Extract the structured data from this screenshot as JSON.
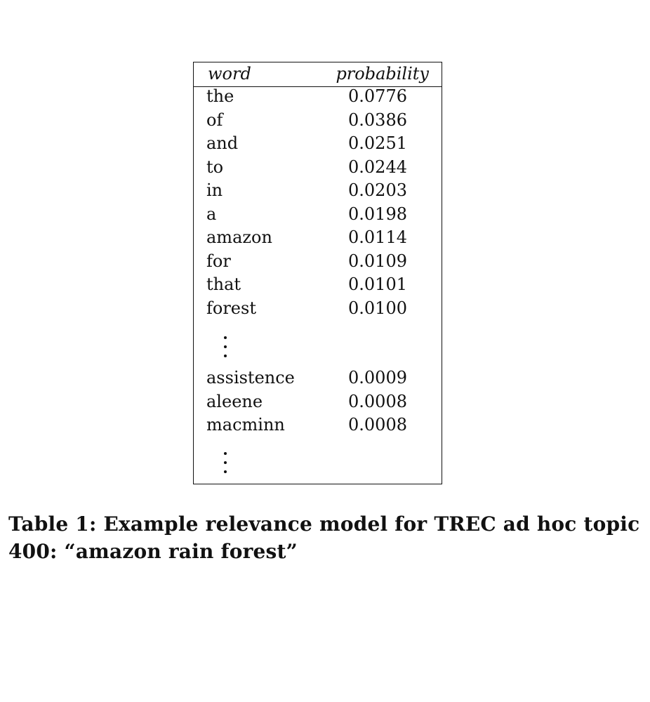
{
  "table": {
    "headers": {
      "word": "word",
      "probability": "probability"
    },
    "rows_top": [
      {
        "word": "the",
        "probability": "0.0776"
      },
      {
        "word": "of",
        "probability": "0.0386"
      },
      {
        "word": "and",
        "probability": "0.0251"
      },
      {
        "word": "to",
        "probability": "0.0244"
      },
      {
        "word": "in",
        "probability": "0.0203"
      },
      {
        "word": "a",
        "probability": "0.0198"
      },
      {
        "word": "amazon",
        "probability": "0.0114"
      },
      {
        "word": "for",
        "probability": "0.0109"
      },
      {
        "word": "that",
        "probability": "0.0101"
      },
      {
        "word": "forest",
        "probability": "0.0100"
      }
    ],
    "rows_bottom": [
      {
        "word": "assistence",
        "probability": "0.0009"
      },
      {
        "word": "aleene",
        "probability": "0.0008"
      },
      {
        "word": "macminn",
        "probability": "0.0008"
      }
    ]
  },
  "caption": {
    "text": "Table 1: Example relevance model for TREC ad hoc topic 400: “amazon rain forest”"
  }
}
